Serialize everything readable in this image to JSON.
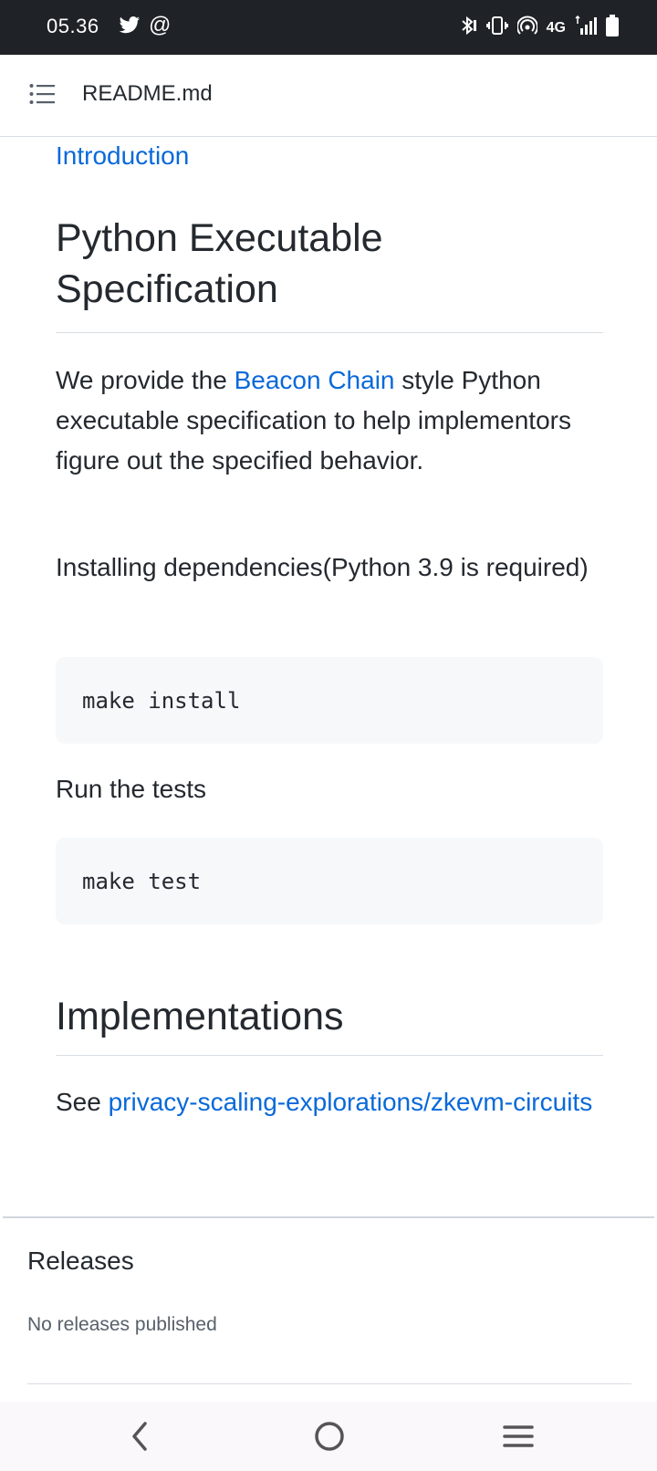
{
  "status_bar": {
    "time": "05.36",
    "at_symbol": "@",
    "network": "4G",
    "icons": [
      "twitter-icon",
      "at-icon",
      "bluetooth-icon",
      "vibrate-icon",
      "hotspot-icon",
      "signal-icon",
      "battery-icon"
    ]
  },
  "header": {
    "title": "README.md",
    "menu_icon": "list-icon"
  },
  "readme": {
    "intro_link": "Introduction",
    "section1": {
      "heading": "Python Executable Specification",
      "para1_prefix": "We provide the ",
      "para1_link": "Beacon Chain",
      "para1_suffix": " style Python executable specification to help implementors figure out the specified behavior.",
      "para2": "Installing dependencies(Python 3.9 is required)",
      "code1": "make install",
      "para3": "Run the tests",
      "code2": "make test"
    },
    "section2": {
      "heading": "Implementations",
      "see_prefix": "See ",
      "see_link": "privacy-scaling-explorations/zkevm-circuits"
    }
  },
  "releases": {
    "title": "Releases",
    "empty_text": "No releases published"
  },
  "nav_bar": {
    "buttons": [
      "back-icon",
      "home-icon",
      "recents-icon"
    ]
  },
  "colors": {
    "link": "#0969da",
    "text": "#24292f",
    "status_bar_bg": "#1f2327",
    "code_bg": "#f6f8fa"
  }
}
